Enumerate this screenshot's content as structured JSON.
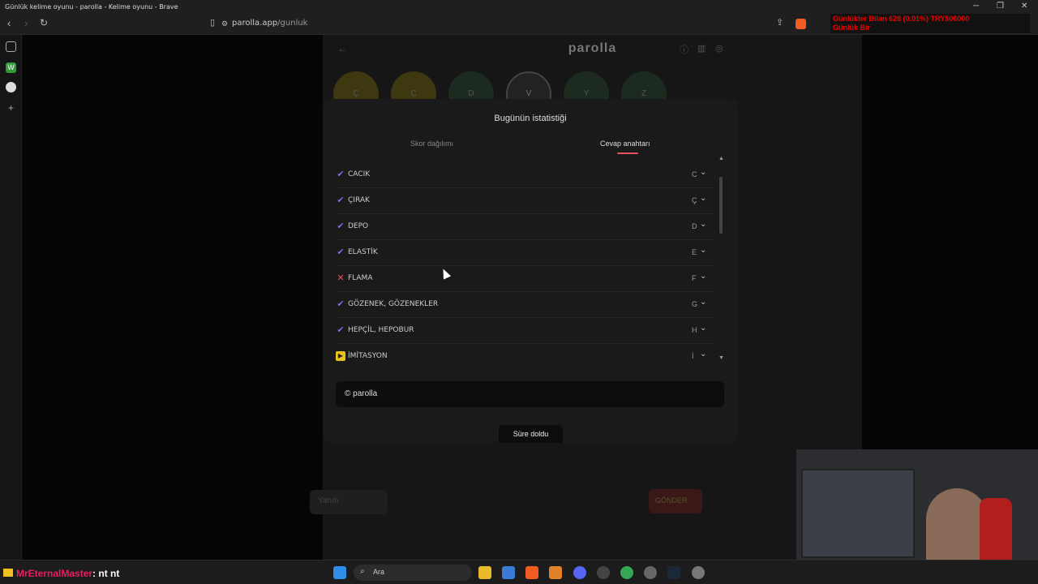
{
  "window": {
    "title": "Günlük kelime oyunu - parolla - Kelime oyunu - Brave",
    "controls": [
      "─",
      "❐",
      "✕"
    ]
  },
  "browser": {
    "url_host": "parolla.app",
    "url_path": "/gunluk"
  },
  "ticker": {
    "line1": "Günlükler Bilan   628 (0.01%)   TRY500000",
    "line2": "Günlük Bir"
  },
  "game": {
    "logo": "parolla",
    "letters": [
      "Ç",
      "Ç",
      "D",
      "V",
      "Y",
      "Z"
    ],
    "bottom_input_placeholder": "Yanıtı",
    "bottom_button": "GÖNDER"
  },
  "modal": {
    "title": "Bugünün istatistiği",
    "tabs": {
      "score": "Skor dağılımı",
      "answers": "Cevap anahtarı"
    },
    "rows": [
      {
        "status": "correct",
        "word": "CACIK",
        "letter": "C"
      },
      {
        "status": "correct",
        "word": "ÇIRAK",
        "letter": "Ç"
      },
      {
        "status": "correct",
        "word": "DEPO",
        "letter": "D"
      },
      {
        "status": "correct",
        "word": "ELASTİK",
        "letter": "E"
      },
      {
        "status": "wrong",
        "word": "FLAMA",
        "letter": "F"
      },
      {
        "status": "correct",
        "word": "GÖZENEK, GÖZENEKLER",
        "letter": "G"
      },
      {
        "status": "correct",
        "word": "HEPÇİL, HEPOBUR",
        "letter": "H"
      },
      {
        "status": "passed",
        "word": "İMİTASYON",
        "letter": "İ"
      }
    ],
    "footer": "© parolla",
    "timeout_button": "Süre doldu"
  },
  "taskbar": {
    "chat_user": "MrEternalMaster",
    "chat_message": ": nt nt",
    "search_label": "Ara"
  },
  "colors": {
    "accent": "#e8505b",
    "correct": "#7b6cf0",
    "wrong": "#e8505b",
    "passed": "#e8c21c"
  }
}
